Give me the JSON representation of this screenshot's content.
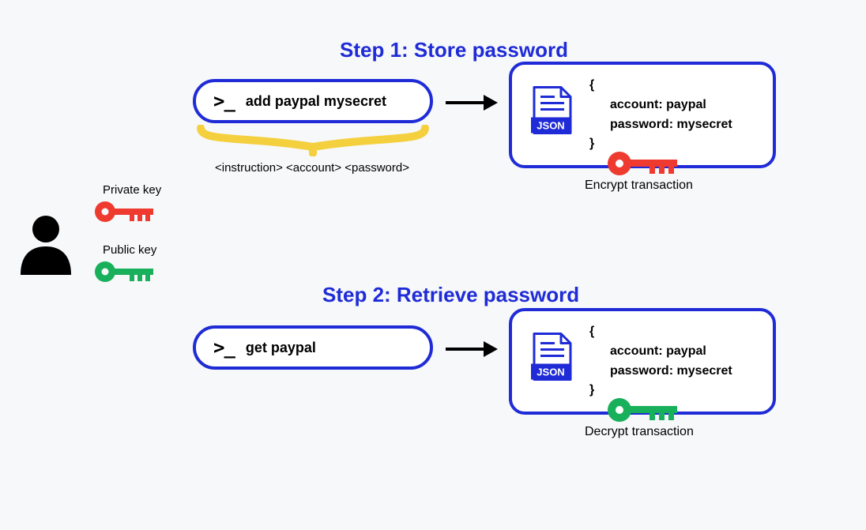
{
  "step1": {
    "title": "Step 1: Store password",
    "command": "add paypal mysecret",
    "syntax_hint": "<instruction> <account> <password>",
    "json": {
      "open_brace": "{",
      "line1": "account: paypal",
      "line2": "password: mysecret",
      "close_brace": "}"
    },
    "action_caption": "Encrypt transaction"
  },
  "step2": {
    "title": "Step 2: Retrieve password",
    "command": "get paypal",
    "json": {
      "open_brace": "{",
      "line1": "account: paypal",
      "line2": "password: mysecret",
      "close_brace": "}"
    },
    "action_caption": "Decrypt transaction"
  },
  "keys": {
    "private_label": "Private key",
    "public_label": "Public key"
  },
  "icons": {
    "json_badge": "JSON"
  },
  "colors": {
    "accent": "#1f2bd6",
    "private_key": "#ef3a2f",
    "public_key": "#18b05b",
    "bracket": "#f4d03f"
  }
}
